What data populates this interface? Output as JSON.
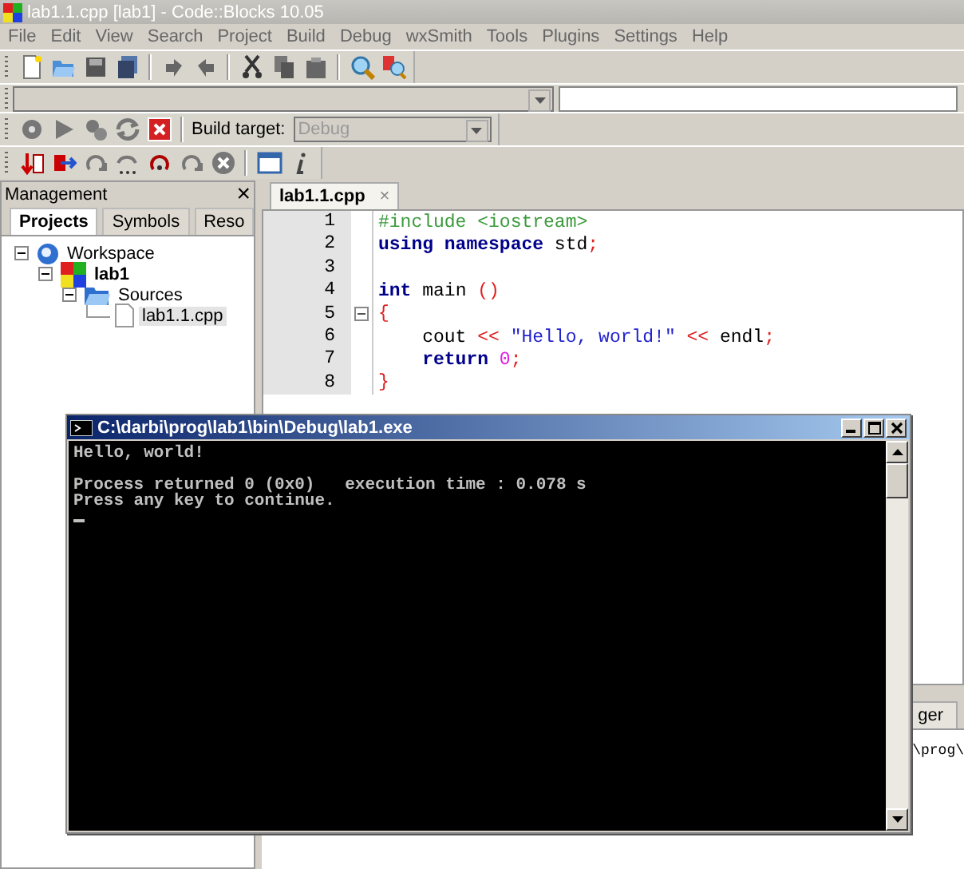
{
  "window": {
    "title": "lab1.1.cpp [lab1] - Code::Blocks 10.05"
  },
  "menu": [
    "File",
    "Edit",
    "View",
    "Search",
    "Project",
    "Build",
    "Debug",
    "wxSmith",
    "Tools",
    "Plugins",
    "Settings",
    "Help"
  ],
  "build_target": {
    "label": "Build target:",
    "value": "Debug",
    "disabled": true
  },
  "management": {
    "title": "Management",
    "close": "×",
    "tabs": [
      {
        "label": "Projects",
        "selected": true
      },
      {
        "label": "Symbols",
        "selected": false
      },
      {
        "label": "Reso",
        "selected": false
      }
    ],
    "tree": [
      {
        "label": "Workspace",
        "kind": "workspace",
        "expanded": true,
        "selected": false,
        "children": [
          {
            "label": "lab1",
            "kind": "project",
            "expanded": true,
            "selected": false,
            "children": [
              {
                "label": "Sources",
                "kind": "folder",
                "expanded": true,
                "selected": false,
                "children": [
                  {
                    "label": "lab1.1.cpp",
                    "kind": "file",
                    "selected": true
                  }
                ]
              }
            ]
          }
        ]
      }
    ]
  },
  "editor": {
    "tab": {
      "label": "lab1.1.cpp",
      "close": "×"
    },
    "lines": [
      {
        "number": "1",
        "tokens": [
          {
            "kind": "preproc",
            "text": "#include <iostream>"
          }
        ]
      },
      {
        "number": "2",
        "tokens": [
          {
            "kind": "keyword",
            "text": "using namespace"
          },
          {
            "kind": "plain",
            "text": " std"
          },
          {
            "kind": "operator",
            "text": ";"
          }
        ]
      },
      {
        "number": "3"
      },
      {
        "number": "4",
        "tokens": [
          {
            "kind": "keyword",
            "text": "int"
          },
          {
            "kind": "plain",
            "text": " main "
          },
          {
            "kind": "operator",
            "text": "()"
          }
        ]
      },
      {
        "number": "5",
        "fold": true,
        "tokens": [
          {
            "kind": "operator",
            "text": "{"
          }
        ]
      },
      {
        "number": "6",
        "indented": true,
        "tokens": [
          {
            "kind": "plain",
            "text": "cout "
          },
          {
            "kind": "operator",
            "text": "<< "
          },
          {
            "kind": "string",
            "text": "\"Hello, world!\""
          },
          {
            "kind": "operator",
            "text": " << "
          },
          {
            "kind": "plain",
            "text": "endl"
          },
          {
            "kind": "operator",
            "text": ";"
          }
        ]
      },
      {
        "number": "7",
        "indented": true,
        "tokens": [
          {
            "kind": "keyword",
            "text": "return "
          },
          {
            "kind": "number",
            "text": "0"
          },
          {
            "kind": "operator",
            "text": ";"
          }
        ]
      },
      {
        "number": "8",
        "tokens": [
          {
            "kind": "operator",
            "text": "}"
          }
        ]
      }
    ]
  },
  "logs": {
    "tab": "ger",
    "line": "\\prog\\"
  },
  "console": {
    "title": "C:\\darbi\\prog\\lab1\\bin\\Debug\\lab1.exe",
    "lines": [
      {
        "kind": "text",
        "text": "Hello, world!"
      },
      {
        "kind": "blank"
      },
      {
        "kind": "text",
        "text": "Process returned 0 (0x0)   execution time : 0.078 s"
      },
      {
        "kind": "text",
        "text": "Press any key to continue."
      }
    ]
  }
}
